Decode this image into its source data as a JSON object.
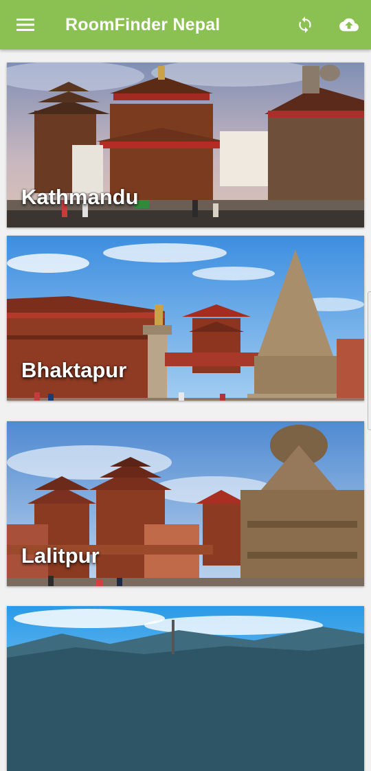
{
  "appbar": {
    "title": "RoomFinder Nepal",
    "icons": {
      "menu": "menu-icon",
      "refresh": "sync-icon",
      "upload": "cloud-upload-icon"
    },
    "color": "#8bc152"
  },
  "cities": [
    {
      "name": "Kathmandu"
    },
    {
      "name": "Bhaktapur"
    },
    {
      "name": "Lalitpur"
    },
    {
      "name": ""
    }
  ]
}
